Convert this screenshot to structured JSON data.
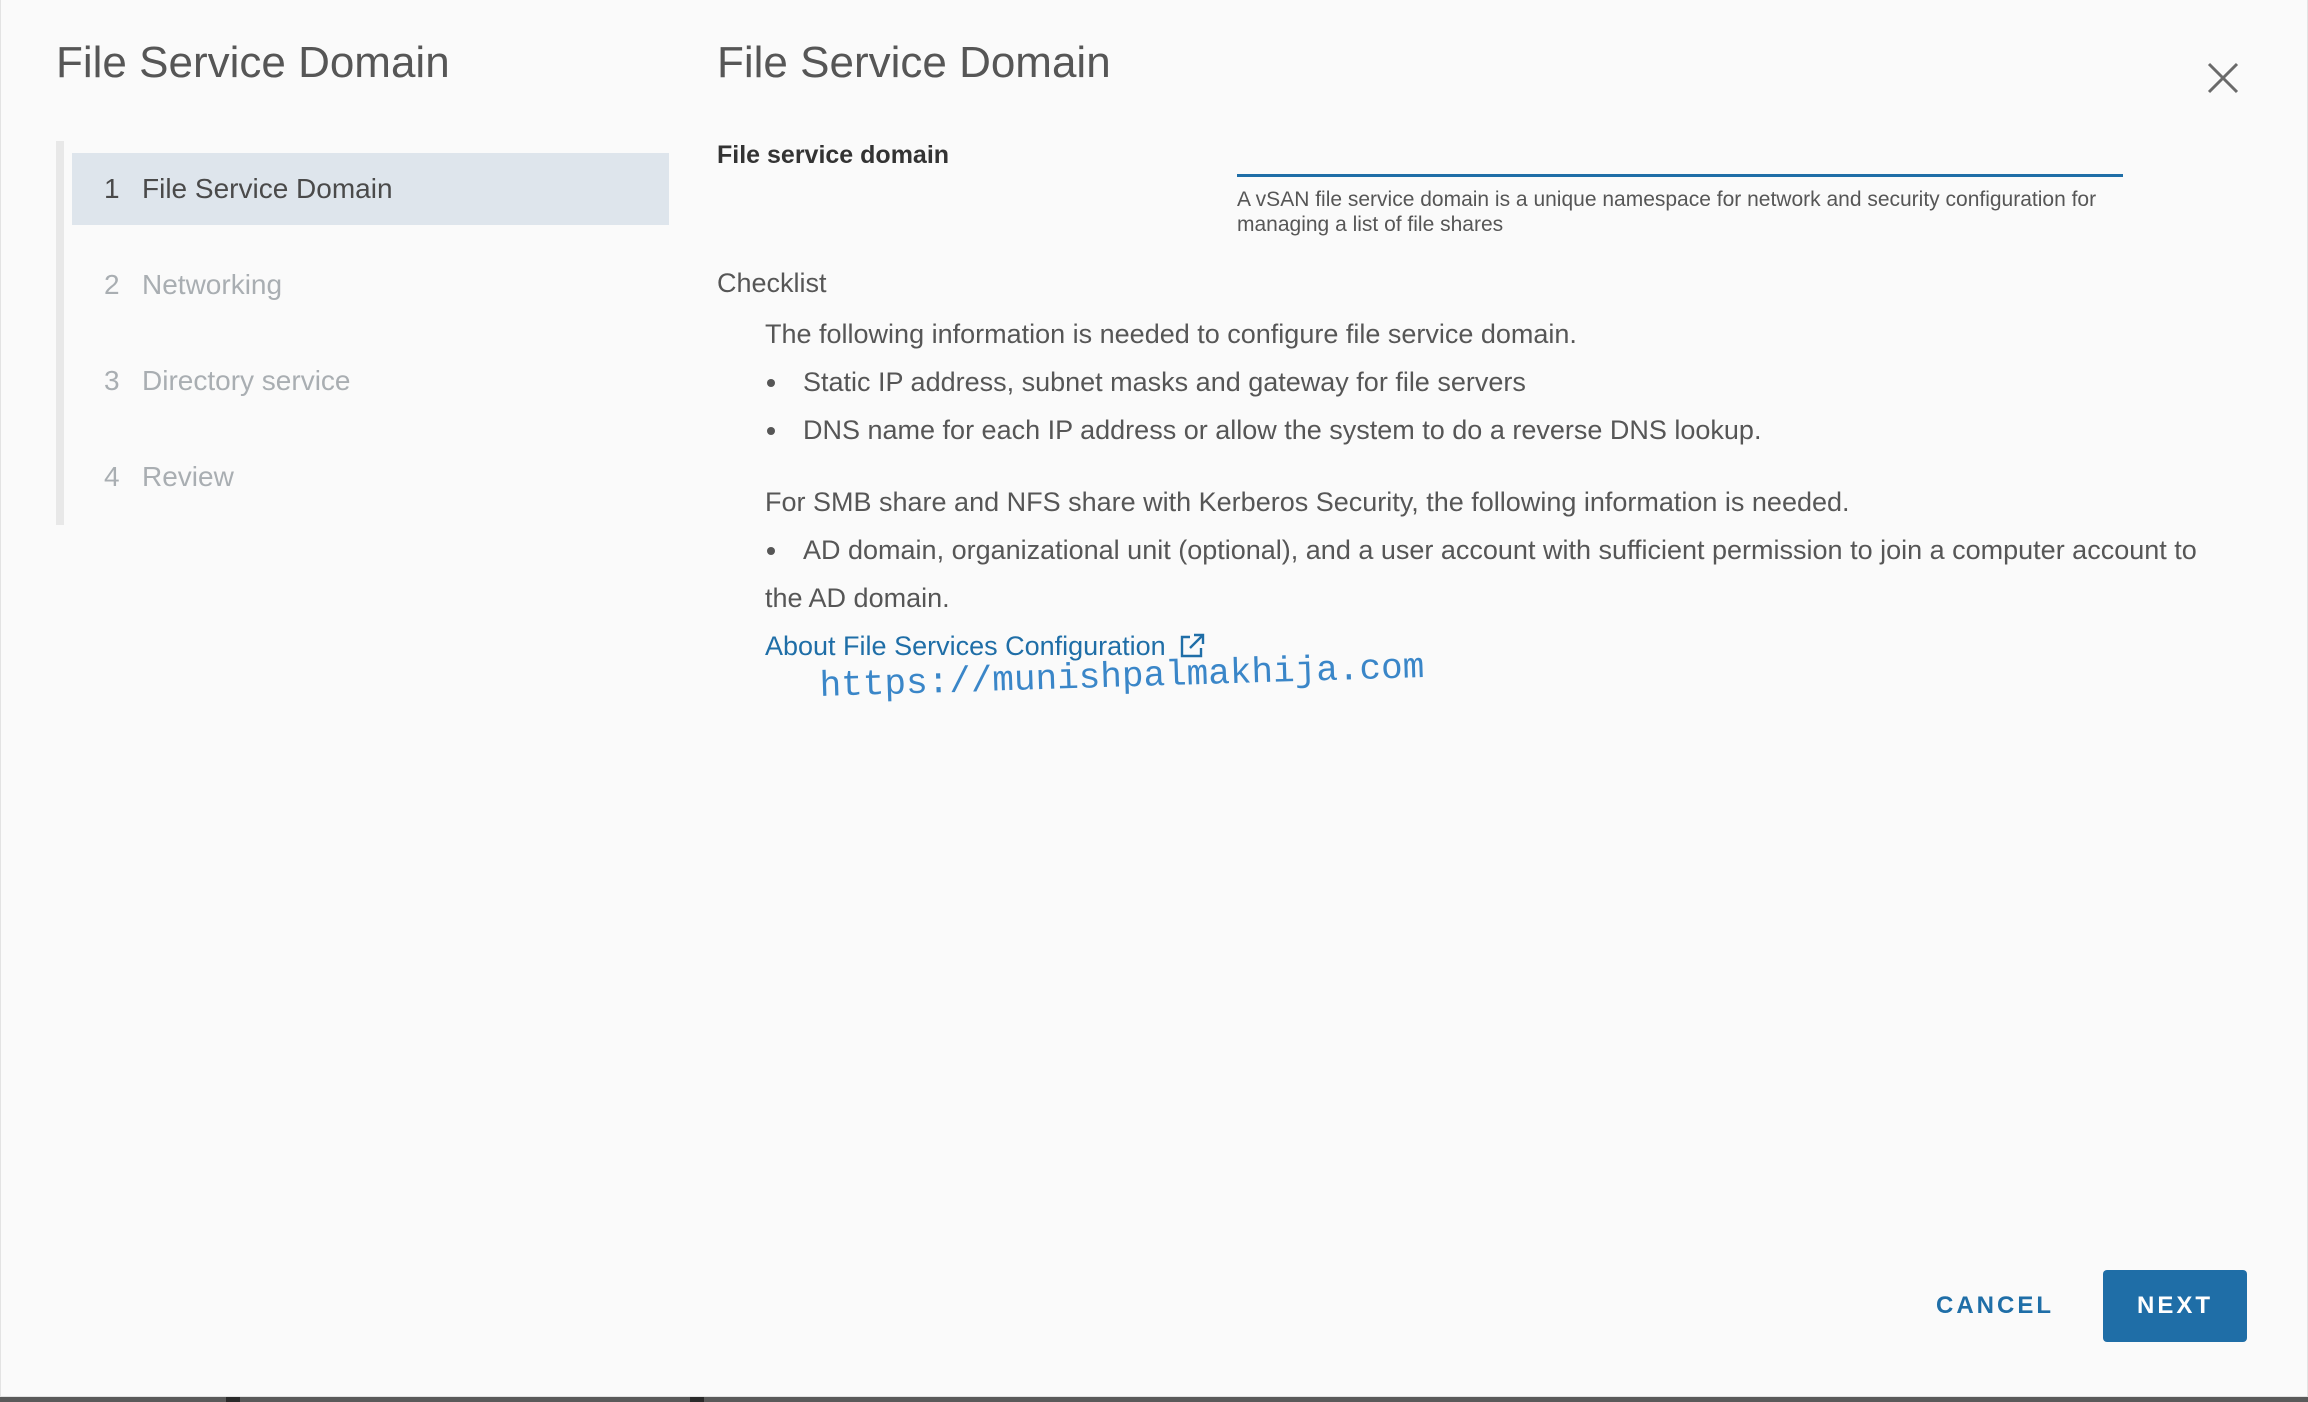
{
  "wizard": {
    "title": "File Service Domain",
    "steps": [
      {
        "number": "1",
        "label": "File Service Domain",
        "active": true
      },
      {
        "number": "2",
        "label": "Networking",
        "active": false
      },
      {
        "number": "3",
        "label": "Directory service",
        "active": false
      },
      {
        "number": "4",
        "label": "Review",
        "active": false
      }
    ]
  },
  "page": {
    "title": "File Service Domain",
    "close_icon": "close-icon"
  },
  "domain_field": {
    "label": "File service domain",
    "value": "",
    "help": "A vSAN file service domain is a unique namespace for network and security configuration for managing a list of file shares"
  },
  "checklist": {
    "title": "Checklist",
    "intro": "The following information is needed to configure file service domain.",
    "items": [
      "Static IP address, subnet masks and gateway for file servers",
      "DNS name for each IP address or allow the system to do a reverse DNS lookup."
    ],
    "smb_intro": "For SMB share and NFS share with Kerberos Security, the following information is needed.",
    "smb_items": [
      "AD domain, organizational unit (optional), and a user account with sufficient permission to join a computer account to the AD domain."
    ],
    "link_label": "About File Services Configuration",
    "link_icon": "external-link-icon"
  },
  "watermark": "https://munishpalmakhija.com",
  "footer": {
    "cancel_label": "CANCEL",
    "next_label": "NEXT"
  },
  "colors": {
    "accent": "#1f6ea7",
    "active_step_bg": "#dee5ec",
    "text": "#565656"
  }
}
